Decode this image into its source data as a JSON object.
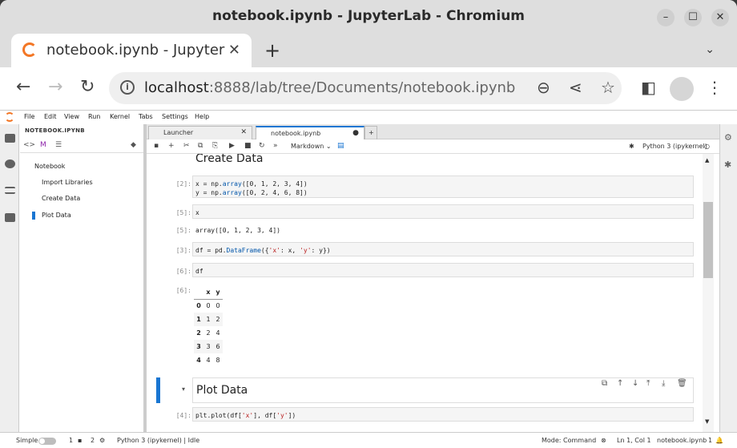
{
  "window": {
    "title": "notebook.ipynb - JupyterLab - Chromium"
  },
  "browser": {
    "tab_title": "notebook.ipynb - Jupyter",
    "url_host": "localhost",
    "url_rest": ":8888/lab/tree/Documents/notebook.ipynb"
  },
  "jupyter": {
    "menu": [
      "File",
      "Edit",
      "View",
      "Run",
      "Kernel",
      "Tabs",
      "Settings",
      "Help"
    ],
    "toc": {
      "header": "NOTEBOOK.IPYNB",
      "items": [
        "Notebook",
        "Import Libraries",
        "Create Data",
        "Plot Data"
      ]
    },
    "tabs": [
      {
        "label": "Launcher"
      },
      {
        "label": "notebook.ipynb"
      }
    ],
    "toolbar": {
      "cell_type": "Markdown",
      "kernel": "Python 3 (ipykernel)"
    },
    "cells": {
      "heading_create": "Create Data",
      "p2": "[2]:",
      "c2_line1_a": "x = np.",
      "c2_line1_b": "array",
      "c2_line1_c": "([0, 1, 2, 3, 4])",
      "c2_line2_a": "y = np.",
      "c2_line2_b": "array",
      "c2_line2_c": "([0, 2, 4, 6, 8])",
      "p5": "[5]:",
      "c5": "x",
      "p5o": "[5]:",
      "o5": "array([0, 1, 2, 3, 4])",
      "p3": "[3]:",
      "c3_a": "df = pd.",
      "c3_b": "DataFrame",
      "c3_c": "({",
      "c3_d": "'x'",
      "c3_e": ": x, ",
      "c3_f": "'y'",
      "c3_g": ": y})",
      "p6": "[6]:",
      "c6": "df",
      "p6o": "[6]:",
      "df_columns": [
        "x",
        "y"
      ],
      "df_rows": [
        [
          "0",
          "0",
          "0"
        ],
        [
          "1",
          "1",
          "2"
        ],
        [
          "2",
          "2",
          "4"
        ],
        [
          "3",
          "3",
          "6"
        ],
        [
          "4",
          "4",
          "8"
        ]
      ],
      "heading_plot": "Plot Data",
      "p4": "[4]:",
      "c4_a": "plt.plot(df[",
      "c4_b": "'x'",
      "c4_c": "], df[",
      "c4_d": "'y'",
      "c4_e": "])"
    },
    "status": {
      "simple": "Simple",
      "n1": "1",
      "n2": "2",
      "kernel": "Python 3 (ipykernel) | Idle",
      "mode": "Mode: Command",
      "pos": "Ln 1, Col 1",
      "file": "notebook.ipynb",
      "bell": "1"
    }
  }
}
